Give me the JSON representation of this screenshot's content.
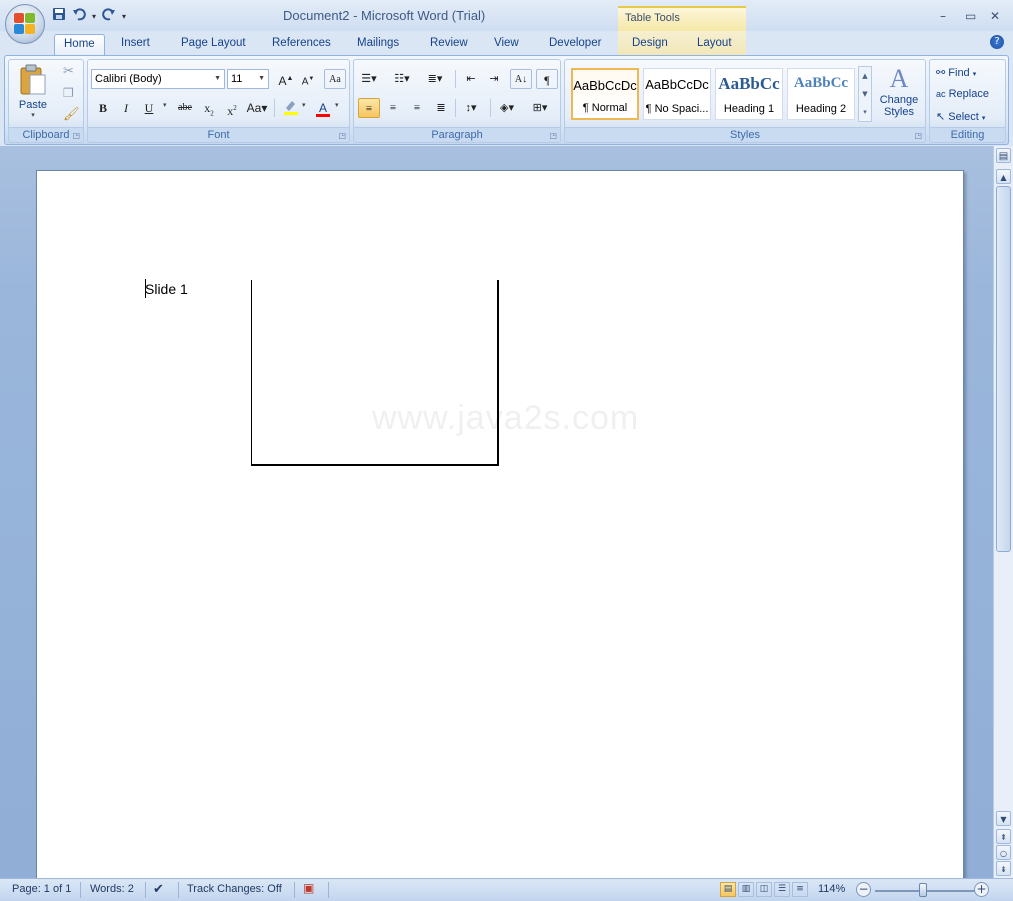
{
  "window": {
    "title": "Document2 - Microsoft Word (Trial)",
    "context_tab_group": "Table Tools",
    "controls": {
      "minimize": "–",
      "maximize": "▭",
      "close": "✕"
    }
  },
  "qat": {
    "save_icon": "save-icon",
    "undo_icon": "undo-icon",
    "redo_icon": "redo-icon"
  },
  "tabs": [
    "Home",
    "Insert",
    "Page Layout",
    "References",
    "Mailings",
    "Review",
    "View",
    "Developer",
    "Design",
    "Layout"
  ],
  "ribbon": {
    "clipboard": {
      "label": "Clipboard",
      "paste": "Paste"
    },
    "font": {
      "label": "Font",
      "font_name": "Calibri (Body)",
      "font_size": "11"
    },
    "paragraph": {
      "label": "Paragraph"
    },
    "styles": {
      "label": "Styles",
      "items": [
        {
          "preview": "AaBbCcDc",
          "name": "¶ Normal"
        },
        {
          "preview": "AaBbCcDc",
          "name": "¶ No Spaci..."
        },
        {
          "preview": "AaBbCc",
          "name": "Heading 1"
        },
        {
          "preview": "AaBbCc",
          "name": "Heading 2"
        }
      ],
      "change_styles_line1": "Change",
      "change_styles_line2": "Styles"
    },
    "editing": {
      "label": "Editing",
      "find": "Find",
      "replace": "Replace",
      "select": "Select"
    }
  },
  "document": {
    "text": "Slide 1",
    "watermark": "www.java2s.com"
  },
  "statusbar": {
    "page": "Page: 1 of 1",
    "words": "Words: 2",
    "track_changes": "Track Changes: Off",
    "zoom": "114%"
  },
  "colors": {
    "accent": "#15428b",
    "highlight": "#ffff00",
    "font_color": "#ff0000",
    "selected": "#f7c55f"
  }
}
